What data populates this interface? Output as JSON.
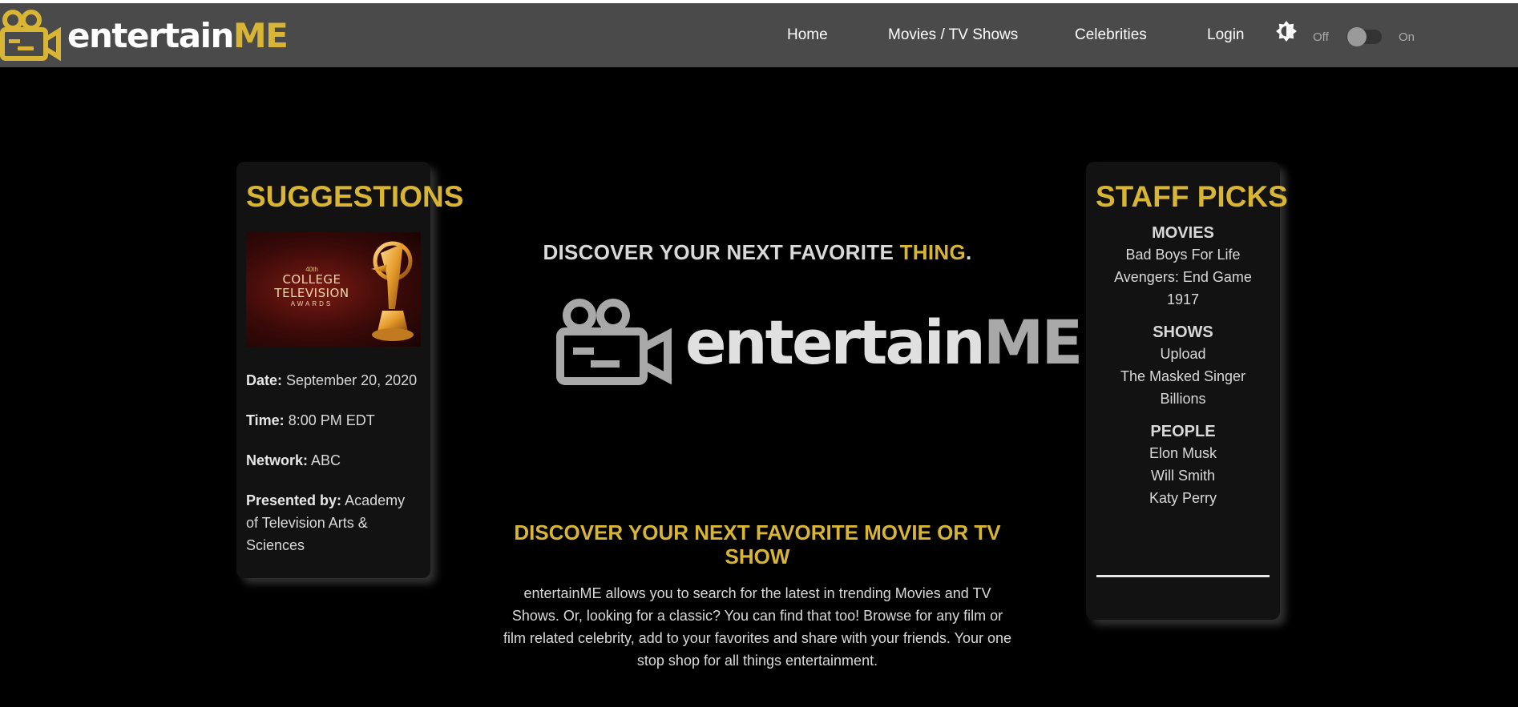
{
  "brand": {
    "name_prefix": "entertain",
    "name_suffix": "ME"
  },
  "nav": {
    "home": "Home",
    "movies_tv": "Movies / TV Shows",
    "celebrities": "Celebrities",
    "login": "Login"
  },
  "theme_toggle": {
    "off_label": "Off",
    "on_label": "On",
    "state": "off",
    "icon": "brightness-icon"
  },
  "suggestions": {
    "title": "SUGGESTIONS",
    "image": {
      "line1": "40th",
      "line2": "COLLEGE",
      "line3": "TELEVISION",
      "line4": "AWARDS"
    },
    "date_label": "Date:",
    "date_value": "September 20, 2020",
    "time_label": "Time:",
    "time_value": "8:00 PM EDT",
    "network_label": "Network:",
    "network_value": "ABC",
    "presented_label": "Presented by:",
    "presented_value": "Academy of Television Arts & Sciences"
  },
  "hero": {
    "tagline_prefix": "DISCOVER YOUR NEXT FAVORITE",
    "tagline_highlight": "THING",
    "tagline_suffix": ".",
    "logo_prefix": "entertain",
    "logo_suffix": "ME"
  },
  "discover": {
    "heading": "DISCOVER YOUR NEXT FAVORITE MOVIE OR TV SHOW",
    "body": "entertainME allows you to search for the latest in trending Movies and TV Shows. Or, looking for a classic? You can find that too! Browse for any film or film related celebrity, add to your favorites and share with your friends. Your one stop shop for all things entertainment."
  },
  "staff_picks": {
    "title": "STAFF PICKS",
    "movies_heading": "MOVIES",
    "movies": [
      "Bad Boys For Life",
      "Avengers: End Game",
      "1917"
    ],
    "shows_heading": "SHOWS",
    "shows": [
      "Upload",
      "The Masked Singer",
      "Billions"
    ],
    "people_heading": "PEOPLE",
    "people": [
      "Elon Musk",
      "Will Smith",
      "Katy Perry"
    ]
  },
  "colors": {
    "accent": "#d8b534",
    "navbar": "#4a4a4a",
    "background": "#000000",
    "card": "#121212"
  }
}
